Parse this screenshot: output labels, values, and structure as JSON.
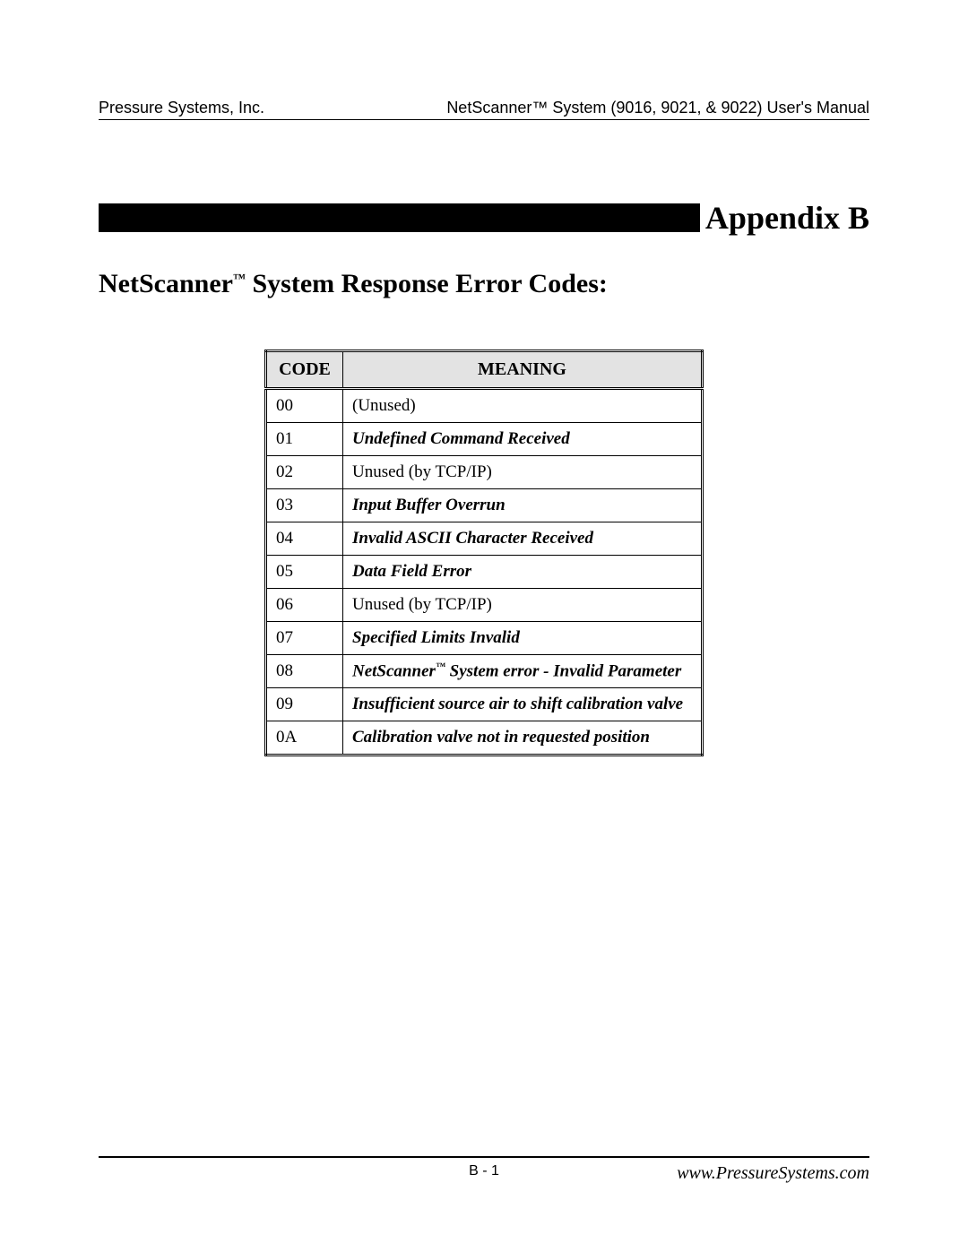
{
  "header": {
    "left": "Pressure Systems, Inc.",
    "right": "NetScanner™ System (9016, 9021, & 9022) User's Manual"
  },
  "appendix": {
    "label": "Appendix B"
  },
  "section": {
    "prefix": "NetScanner",
    "tm": "™",
    "suffix": " System Response Error Codes:"
  },
  "table": {
    "head": {
      "code": "CODE",
      "meaning": "MEANING"
    },
    "rows": [
      {
        "code": "00",
        "meaning": "(Unused)",
        "emph": false,
        "tm": false
      },
      {
        "code": "01",
        "meaning": "Undefined Command Received",
        "emph": true,
        "tm": false
      },
      {
        "code": "02",
        "meaning": "Unused (by TCP/IP)",
        "emph": false,
        "tm": false
      },
      {
        "code": "03",
        "meaning": "Input Buffer Overrun",
        "emph": true,
        "tm": false
      },
      {
        "code": "04",
        "meaning": "Invalid ASCII Character Received",
        "emph": true,
        "tm": false
      },
      {
        "code": "05",
        "meaning": "Data Field Error",
        "emph": true,
        "tm": false
      },
      {
        "code": "06",
        "meaning": "Unused (by TCP/IP)",
        "emph": false,
        "tm": false
      },
      {
        "code": "07",
        "meaning": "Specified Limits Invalid",
        "emph": true,
        "tm": false
      },
      {
        "code": "08",
        "meaning_pre": "NetScanner",
        "tm": true,
        "meaning_post": " System error - Invalid Parameter",
        "emph": true
      },
      {
        "code": "09",
        "meaning": "Insufficient source air to shift calibration valve",
        "emph": true,
        "tm": false
      },
      {
        "code": "0A",
        "meaning": "Calibration valve not in requested position",
        "emph": true,
        "tm": false
      }
    ]
  },
  "footer": {
    "center": "B - 1",
    "right": "www.PressureSystems.com"
  }
}
